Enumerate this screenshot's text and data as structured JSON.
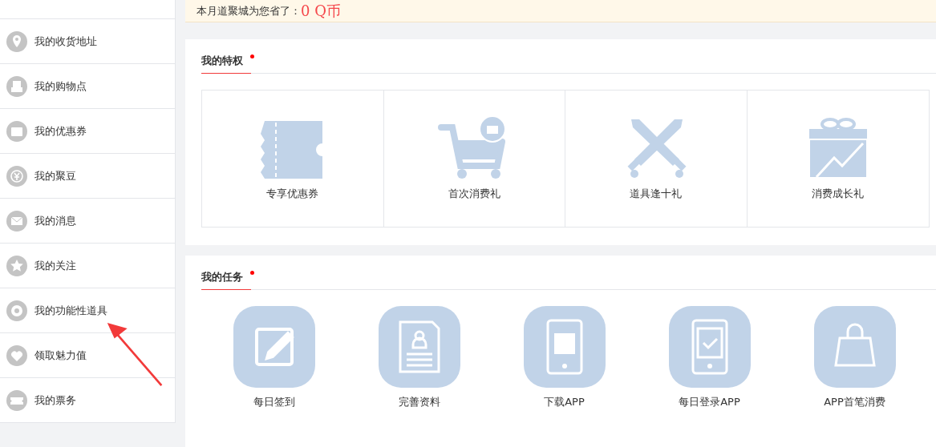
{
  "sidebar": {
    "items": [
      {
        "label": "我的收货地址"
      },
      {
        "label": "我的购物点"
      },
      {
        "label": "我的优惠券"
      },
      {
        "label": "我的聚豆"
      },
      {
        "label": "我的消息"
      },
      {
        "label": "我的关注"
      },
      {
        "label": "我的功能性道具"
      },
      {
        "label": "领取魅力值"
      },
      {
        "label": "我的票务"
      }
    ]
  },
  "savings_banner": {
    "label": "本月道聚城为您省了：",
    "amount": "0 Q币"
  },
  "privileges": {
    "title": "我的特权",
    "items": [
      {
        "label": "专享优惠券"
      },
      {
        "label": "首次消费礼"
      },
      {
        "label": "道具逢十礼"
      },
      {
        "label": "消费成长礼"
      }
    ]
  },
  "tasks": {
    "title": "我的任务",
    "items": [
      {
        "label": "每日签到"
      },
      {
        "label": "完善资料"
      },
      {
        "label": "下载APP"
      },
      {
        "label": "每日登录APP"
      },
      {
        "label": "APP首笔消费"
      }
    ]
  }
}
